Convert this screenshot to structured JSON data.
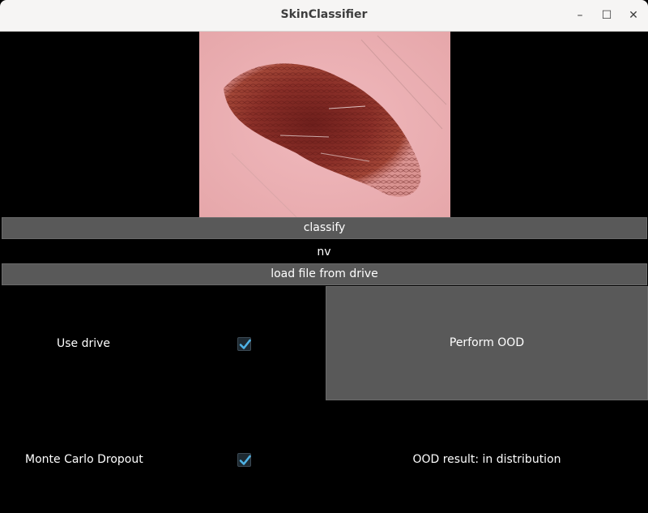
{
  "window": {
    "title": "SkinClassifier"
  },
  "controls": {
    "minimize": "–",
    "maximize": "☐",
    "close": "✕"
  },
  "buttons": {
    "classify": "classify",
    "load_file": "load file from drive",
    "perform_ood": "Perform OOD"
  },
  "result": {
    "classification": "nv",
    "ood": "OOD result: in distribution"
  },
  "options": {
    "use_drive": {
      "label": "Use drive",
      "checked": true
    },
    "mc_dropout": {
      "label": "Monte Carlo Dropout",
      "checked": true
    }
  },
  "image": {
    "description": "dermoscopy-lesion"
  },
  "colors": {
    "accent": "#4fb3e6",
    "button_bg": "#595959",
    "window_bg": "#000000"
  }
}
